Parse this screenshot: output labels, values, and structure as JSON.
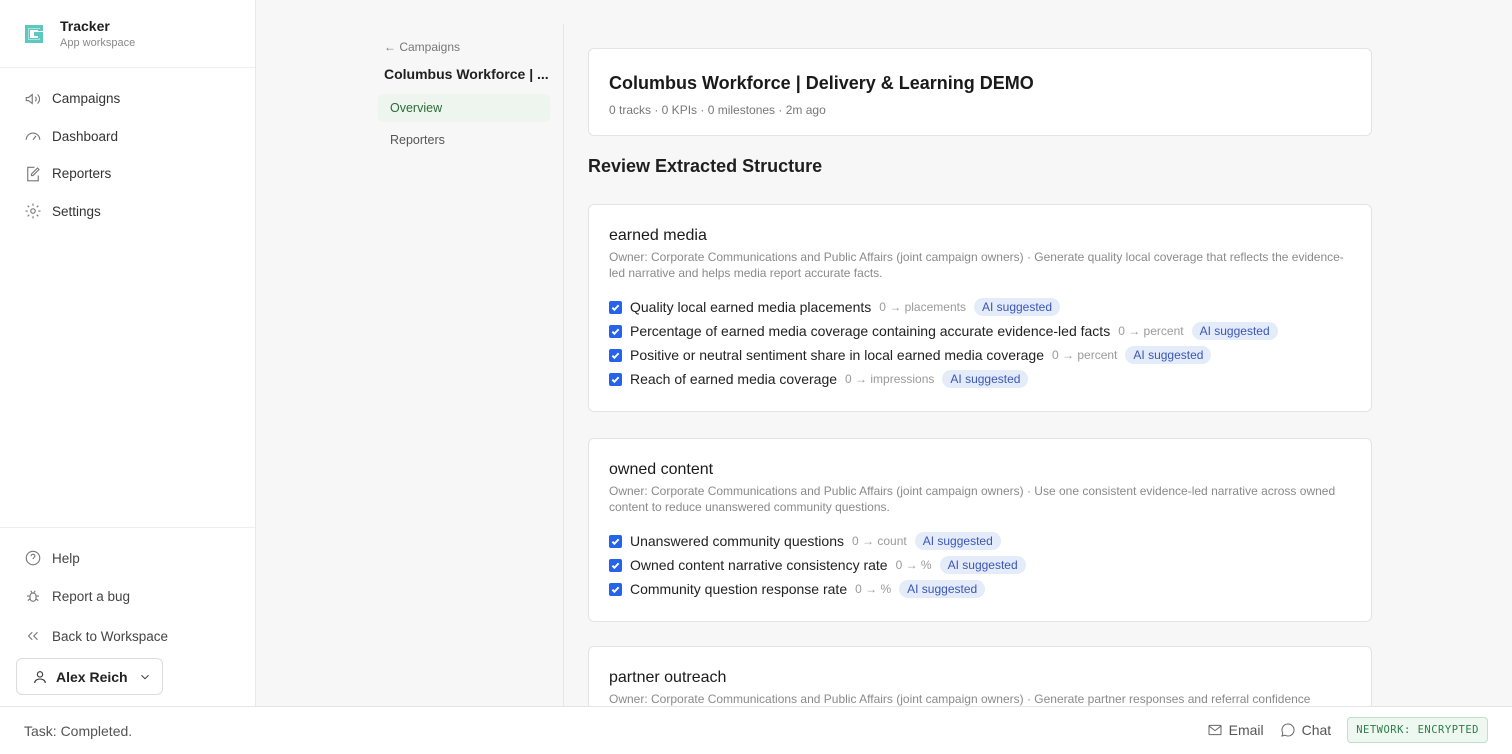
{
  "app": {
    "name": "Tracker",
    "subtitle": "App workspace"
  },
  "sidebar": {
    "items": [
      {
        "label": "Campaigns",
        "icon": "megaphone-icon"
      },
      {
        "label": "Dashboard",
        "icon": "gauge-icon"
      },
      {
        "label": "Reporters",
        "icon": "edit-doc-icon"
      },
      {
        "label": "Settings",
        "icon": "gear-icon"
      }
    ],
    "bottom": [
      {
        "label": "Help",
        "icon": "help-circle-icon"
      },
      {
        "label": "Report a bug",
        "icon": "bug-icon"
      },
      {
        "label": "Back to Workspace",
        "icon": "double-chevron-left-icon"
      }
    ],
    "user": {
      "name": "Alex Reich"
    }
  },
  "subnav": {
    "back_label": "← Campaigns",
    "title": "Columbus Workforce | ...",
    "items": [
      {
        "label": "Overview",
        "active": true
      },
      {
        "label": "Reporters",
        "active": false
      }
    ]
  },
  "header": {
    "title": "Columbus Workforce | Delivery & Learning DEMO",
    "meta": "0 tracks · 0 KPIs · 0 milestones · 2m ago"
  },
  "section_title": "Review Extracted Structure",
  "tracks": [
    {
      "name": "earned media",
      "description": "Owner: Corporate Communications and Public Affairs (joint campaign owners) · Generate quality local coverage that reflects the evidence-led narrative and helps media report accurate facts.",
      "kpis": [
        {
          "label": "Quality local earned media placements",
          "target": "0 → placements",
          "badge": "AI suggested",
          "checked": true
        },
        {
          "label": "Percentage of earned media coverage containing accurate evidence-led facts",
          "target": "0 → percent",
          "badge": "AI suggested",
          "checked": true
        },
        {
          "label": "Positive or neutral sentiment share in local earned media coverage",
          "target": "0 → percent",
          "badge": "AI suggested",
          "checked": true
        },
        {
          "label": "Reach of earned media coverage",
          "target": "0 → impressions",
          "badge": "AI suggested",
          "checked": true
        }
      ]
    },
    {
      "name": "owned content",
      "description": "Owner: Corporate Communications and Public Affairs (joint campaign owners) · Use one consistent evidence-led narrative across owned content to reduce unanswered community questions.",
      "kpis": [
        {
          "label": "Unanswered community questions",
          "target": "0 → count",
          "badge": "AI suggested",
          "checked": true
        },
        {
          "label": "Owned content narrative consistency rate",
          "target": "0 → %",
          "badge": "AI suggested",
          "checked": true
        },
        {
          "label": "Community question response rate",
          "target": "0 → %",
          "badge": "AI suggested",
          "checked": true
        }
      ]
    },
    {
      "name": "partner outreach",
      "description": "Owner: Corporate Communications and Public Affairs (joint campaign owners) · Generate partner responses and referral confidence among educators, workforce partners, employers, and community organizations.",
      "kpis": []
    }
  ],
  "footer": {
    "status": "Task: Completed.",
    "email_label": "Email",
    "chat_label": "Chat",
    "network_badge": "NETWORK: ENCRYPTED"
  }
}
